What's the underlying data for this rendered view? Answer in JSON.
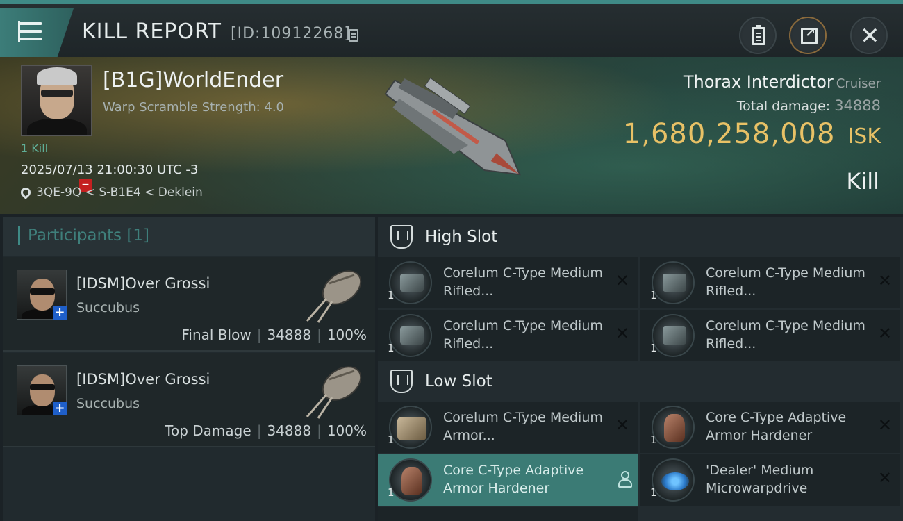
{
  "header": {
    "title": "KILL REPORT",
    "report_id": "[ID:10912268]"
  },
  "victim": {
    "name": "[B1G]WorldEnder",
    "warp_scramble": "Warp Scramble Strength: 4.0",
    "kill_count": "1 Kill",
    "datetime": "2025/07/13 21:00:30 UTC -3",
    "location": "3QE-9Q < S-B1E4 < Deklein",
    "ship_name": "Thorax Interdictor",
    "ship_class": "Cruiser",
    "total_damage_label": "Total damage:",
    "total_damage": "34888",
    "isk_value": "1,680,258,008",
    "isk_unit": "ISK",
    "result": "Kill"
  },
  "participants": {
    "title": "Participants [1]",
    "rows": [
      {
        "name": "[IDSM]Over Grossi",
        "ship": "Succubus",
        "role": "Final Blow",
        "damage": "34888",
        "percent": "100%"
      },
      {
        "name": "[IDSM]Over Grossi",
        "ship": "Succubus",
        "role": "Top Damage",
        "damage": "34888",
        "percent": "100%"
      }
    ]
  },
  "fitting": {
    "high_slot_title": "High Slot",
    "low_slot_title": "Low Slot",
    "high_slot": [
      {
        "qty": "1",
        "name": "Corelum C-Type Medium Rifled...",
        "icon": "turret-icon",
        "state": "destroyed"
      },
      {
        "qty": "1",
        "name": "Corelum C-Type Medium Rifled...",
        "icon": "turret-icon",
        "state": "destroyed"
      },
      {
        "qty": "1",
        "name": "Corelum C-Type Medium Rifled...",
        "icon": "turret-icon",
        "state": "destroyed"
      },
      {
        "qty": "1",
        "name": "Corelum C-Type Medium Rifled...",
        "icon": "turret-icon",
        "state": "destroyed"
      }
    ],
    "low_slot": [
      {
        "qty": "1",
        "name": "Corelum C-Type Medium Armor...",
        "icon": "armor-plate-icon",
        "state": "destroyed"
      },
      {
        "qty": "1",
        "name": "Core C-Type Adaptive Armor Hardener",
        "icon": "armor-hardener-icon",
        "state": "destroyed"
      },
      {
        "qty": "1",
        "name": "Core C-Type Adaptive Armor Hardener",
        "icon": "armor-hardener-icon",
        "state": "dropped"
      },
      {
        "qty": "1",
        "name": "'Dealer' Medium Microwarpdrive",
        "icon": "microwarpdrive-icon",
        "state": "destroyed"
      }
    ]
  },
  "colors": {
    "accent": "#3f8a86",
    "isk": "#e8c166",
    "highlight_row": "#3b7b75"
  }
}
